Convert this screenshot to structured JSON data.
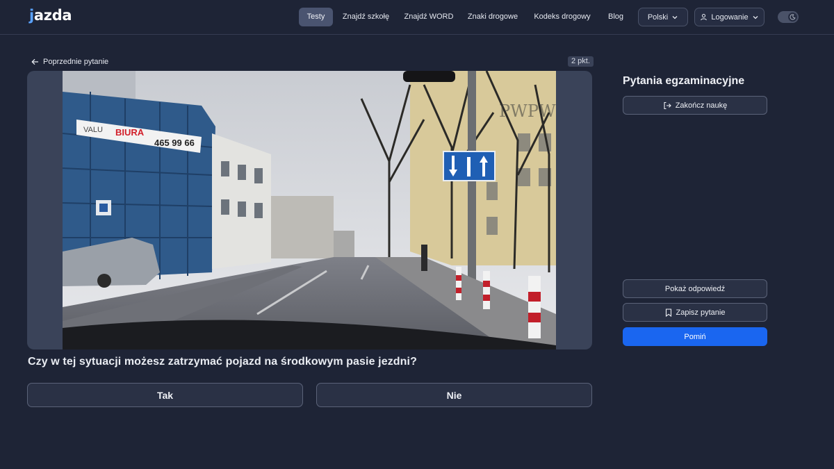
{
  "header": {
    "logo": "jazda",
    "nav": [
      {
        "label": "Testy",
        "active": true
      },
      {
        "label": "Znajdź szkołę",
        "active": false
      },
      {
        "label": "Znajdź WORD",
        "active": false
      },
      {
        "label": "Znaki drogowe",
        "active": false
      },
      {
        "label": "Kodeks drogowy",
        "active": false
      },
      {
        "label": "Blog",
        "active": false
      }
    ],
    "language": "Polski",
    "login": "Logowanie"
  },
  "question": {
    "back_label": "Poprzednie pytanie",
    "points": "2 pkt.",
    "text": "Czy w tej sytuacji możesz zatrzymać pojazd na środkowym pasie jezdni?",
    "answers": [
      "Tak",
      "Nie"
    ],
    "media": {
      "billboard": "BIURA",
      "billboard_prefix": "VALU",
      "billboard_phone": "465 99 66",
      "watermark": "PWPW"
    }
  },
  "panel": {
    "title": "Pytania egzaminacyjne",
    "end_label": "Zakończ naukę",
    "show_answer_label": "Pokaż odpowiedź",
    "save_label": "Zapisz pytanie",
    "skip_label": "Pomiń"
  },
  "colors": {
    "background": "#1e2436",
    "primary": "#1a66f0",
    "logo_accent": "#5aa2ff"
  }
}
